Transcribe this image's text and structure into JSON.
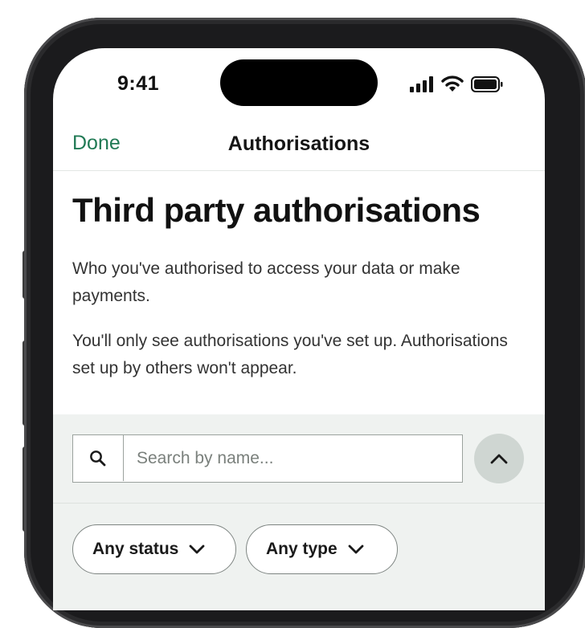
{
  "status_bar": {
    "time": "9:41"
  },
  "nav": {
    "done_label": "Done",
    "title": "Authorisations"
  },
  "page": {
    "heading": "Third party authorisations",
    "description_1": "Who you've authorised to access your data or make payments.",
    "description_2": "You'll only see authorisations you've set up. Authorisations set up by others won't appear."
  },
  "filters": {
    "search_placeholder": "Search by name...",
    "search_value": "",
    "status_filter_label": "Any status",
    "type_filter_label": "Any type"
  },
  "colors": {
    "accent": "#217a55",
    "panel_background": "#eff2f0",
    "collapse_button": "#cfd6d2"
  },
  "icons": [
    "signal-icon",
    "wifi-icon",
    "battery-icon",
    "search-icon",
    "chevron-up-icon",
    "chevron-down-icon"
  ]
}
